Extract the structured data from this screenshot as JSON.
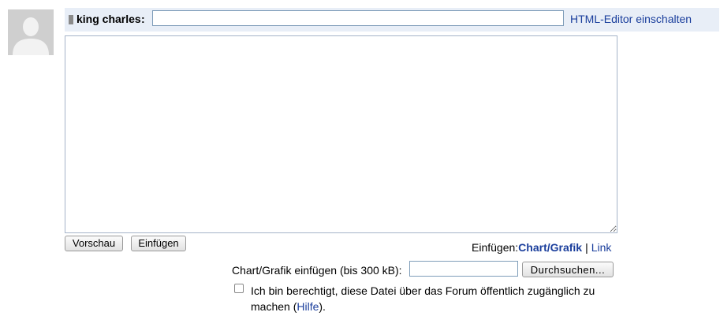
{
  "header": {
    "author_name": "king charles",
    "author_colon": ":",
    "subject_value": "",
    "html_editor_link": "HTML-Editor einschalten"
  },
  "editor": {
    "value": ""
  },
  "actions": {
    "preview_label": "Vorschau",
    "insert_label": "Einfügen"
  },
  "insert_menu": {
    "label": "Einfügen:",
    "chart_link": "Chart/Grafik",
    "separator": "|",
    "link_link": "Link"
  },
  "upload": {
    "label": "Chart/Grafik einfügen (bis 300 kB):",
    "browse_label": "Durchsuchen..."
  },
  "consent": {
    "text_before": "Ich bin berechtigt, diese Datei über das Forum öffentlich zugänglich zu machen (",
    "help_link": "Hilfe",
    "text_after": ").",
    "checked": false
  },
  "colors": {
    "link": "#1a3e9c",
    "header_bg": "#e8eef7",
    "avatar_bg": "#cfcfcf"
  }
}
